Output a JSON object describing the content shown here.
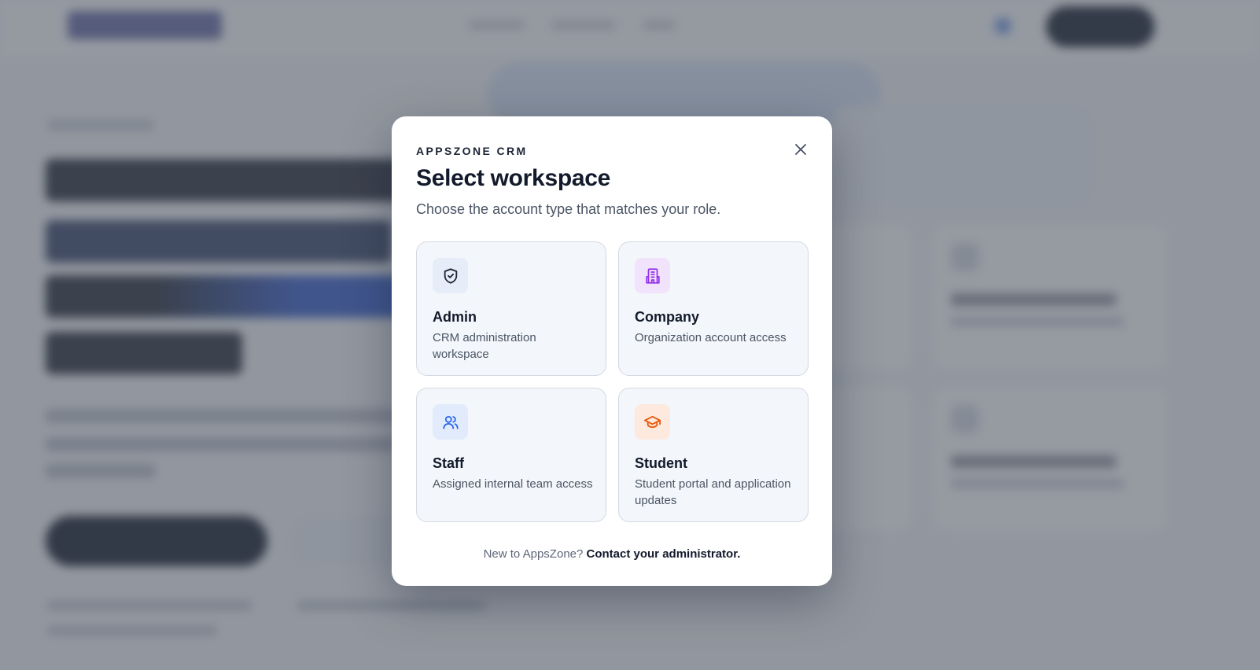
{
  "modal": {
    "brand": "APPSZONE CRM",
    "title": "Select workspace",
    "subtitle": "Choose the account type that matches your role.",
    "close_icon": "close-icon",
    "cards": [
      {
        "title": "Admin",
        "description": "CRM administration workspace",
        "icon": "shield-check-icon",
        "icon_bg": "#e6edf8",
        "icon_color": "#1c2536"
      },
      {
        "title": "Company",
        "description": "Organization account access",
        "icon": "building-icon",
        "icon_bg": "#f1e3fb",
        "icon_color": "#9333ea"
      },
      {
        "title": "Staff",
        "description": "Assigned internal team access",
        "icon": "users-icon",
        "icon_bg": "#e1ebfc",
        "icon_color": "#2563eb"
      },
      {
        "title": "Student",
        "description": "Student portal and application updates",
        "icon": "graduation-cap-icon",
        "icon_bg": "#fde9dd",
        "icon_color": "#ea580c"
      }
    ],
    "footer": {
      "prefix": "New to AppsZone?",
      "link": "Contact your administrator."
    }
  },
  "colors": {
    "overlay": "#50566094",
    "text_primary": "#121a2b",
    "text_secondary": "#4b5565"
  }
}
